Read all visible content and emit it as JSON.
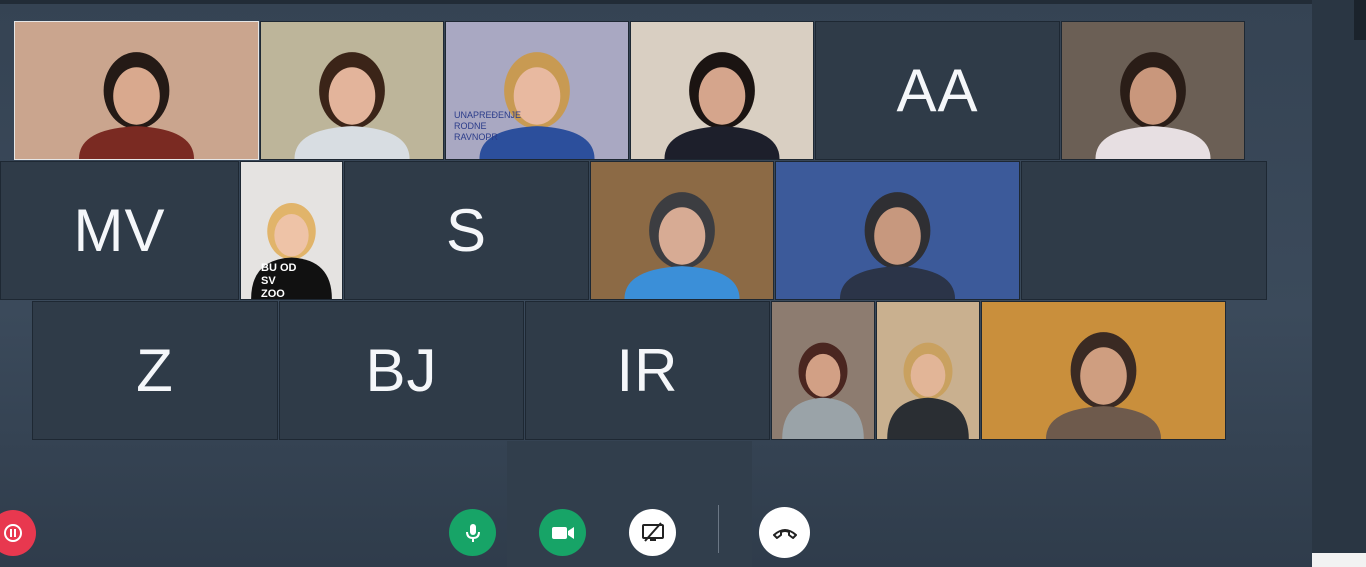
{
  "meeting": {
    "participants_row1": [
      {
        "type": "video",
        "label": "participant-1",
        "bg": "#caa58e",
        "shirt": "#7a2a22",
        "hair": "#241a16",
        "skin": "#d9a98e"
      },
      {
        "type": "video",
        "label": "participant-2",
        "bg": "#bdb59a",
        "shirt": "#d8dde2",
        "hair": "#3b2418",
        "skin": "#e3b49b"
      },
      {
        "type": "video",
        "label": "participant-3",
        "bg": "#a9a8c2",
        "shirt": "#2c4f9c",
        "hair": "#c89a52",
        "skin": "#e8b9a0",
        "banner_text": "UNAPREĐENJE RODNE RAVNOPR"
      },
      {
        "type": "video",
        "label": "participant-4",
        "bg": "#d9cfc2",
        "shirt": "#1d1f2b",
        "hair": "#1b1412",
        "skin": "#d5a58c"
      },
      {
        "type": "avatar",
        "initials": "AA"
      },
      {
        "type": "video",
        "label": "participant-6",
        "bg": "#6b5f55",
        "shirt": "#e7dfe2",
        "hair": "#2a1d17",
        "skin": "#c9977c"
      }
    ],
    "participants_row2": [
      {
        "type": "avatar",
        "initials": "MV"
      },
      {
        "type": "video",
        "label": "participant-8",
        "bg": "#e5e3e1",
        "shirt": "#111111",
        "hair": "#e1b46a",
        "skin": "#eec3a7",
        "shirt_text": "BU OD SV ZOO"
      },
      {
        "type": "avatar",
        "initials": "S"
      },
      {
        "type": "video",
        "label": "participant-10",
        "bg": "#8c6a45",
        "shirt": "#3b8fd8",
        "hair": "#3c3d41",
        "skin": "#d7ab94"
      },
      {
        "type": "video",
        "label": "participant-11",
        "bg": "#3c5a9a",
        "shirt": "#2b3448",
        "hair": "#2f2f33",
        "skin": "#c7987e"
      },
      {
        "type": "empty"
      }
    ],
    "participants_row3": [
      {
        "type": "avatar",
        "initials": "Z"
      },
      {
        "type": "avatar",
        "initials": "BJ"
      },
      {
        "type": "avatar",
        "initials": "IR"
      },
      {
        "type": "video",
        "label": "participant-15",
        "bg": "#8d7c70",
        "shirt": "#9aa3a8",
        "hair": "#4a2620",
        "skin": "#d2a085"
      },
      {
        "type": "video",
        "label": "participant-16",
        "bg": "#c9b08f",
        "shirt": "#2a2e33",
        "hair": "#c9a160",
        "skin": "#e2b597"
      },
      {
        "type": "video",
        "label": "participant-17",
        "bg": "#c98f3c",
        "shirt": "#6e5a4c",
        "hair": "#3a2a23",
        "skin": "#cf9e80"
      }
    ]
  },
  "controls": {
    "pause_color": "#e8384f",
    "mic_color": "#17a467",
    "camera_color": "#17a467",
    "share_color": "#ffffff",
    "hangup_color": "#ffffff"
  }
}
